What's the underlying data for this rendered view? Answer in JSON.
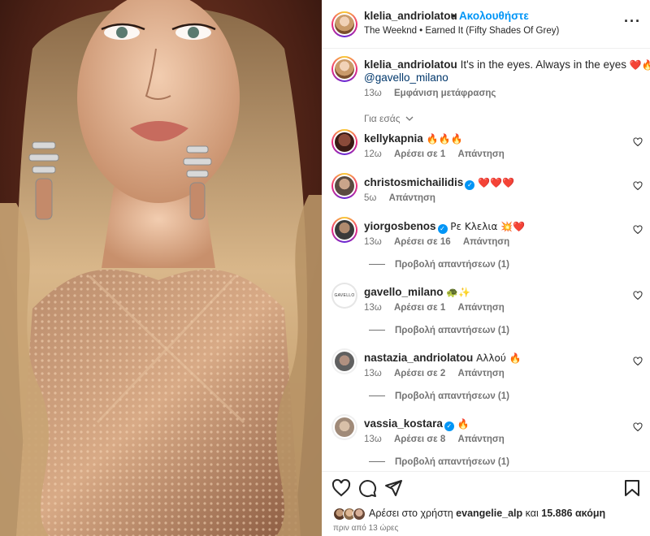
{
  "header": {
    "username": "klelia_andriolatou",
    "separator": "•",
    "follow_label": "Ακολουθήστε",
    "song": "The Weeknd • Earned It (Fifty Shades Of Grey)",
    "more_label": "···"
  },
  "caption": {
    "username": "klelia_andriolatou",
    "text": "It's in the eyes. Always in the eyes",
    "emojis": "❤️🔥",
    "mention": "@gavello_milano",
    "time": "13ω",
    "translate_label": "Εμφάνιση μετάφρασης"
  },
  "for_you_label": "Για εσάς",
  "comments": [
    {
      "username": "kellykapnia",
      "text": "🔥🔥🔥",
      "verified": false,
      "time": "12ω",
      "likes": "Αρέσει σε 1",
      "reply": "Απάντηση",
      "view_replies": ""
    },
    {
      "username": "christosmichailidis",
      "text": "❤️❤️❤️",
      "verified": true,
      "time": "5ω",
      "likes": "",
      "reply": "Απάντηση",
      "view_replies": ""
    },
    {
      "username": "yiorgosbenos",
      "text": "Ρε Κλελια 💥❤️",
      "verified": true,
      "time": "13ω",
      "likes": "Αρέσει σε 16",
      "reply": "Απάντηση",
      "view_replies": "Προβολή απαντήσεων (1)"
    },
    {
      "username": "gavello_milano",
      "text": "🐢✨",
      "verified": false,
      "time": "13ω",
      "likes": "Αρέσει σε 1",
      "reply": "Απάντηση",
      "view_replies": "Προβολή απαντήσεων (1)",
      "avatar_text": "GAVELLO"
    },
    {
      "username": "nastazia_andriolatou",
      "text": "Αλλού 🔥",
      "verified": false,
      "time": "13ω",
      "likes": "Αρέσει σε 2",
      "reply": "Απάντηση",
      "view_replies": "Προβολή απαντήσεων (1)"
    },
    {
      "username": "vassia_kostara",
      "text": "🔥",
      "verified": true,
      "time": "13ω",
      "likes": "Αρέσει σε 8",
      "reply": "Απάντηση",
      "view_replies": "Προβολή απαντήσεων (1)"
    }
  ],
  "footer": {
    "likes_prefix": "Αρέσει στο χρήστη",
    "liked_by": "evangelie_alp",
    "likes_middle": "και",
    "likes_count": "15.886 ακόμη",
    "time_ago": "πριν από 13 ώρες"
  },
  "colors": {
    "accent": "#0095f6",
    "text": "#262626",
    "muted": "#737373",
    "heart": "#ed4956"
  }
}
